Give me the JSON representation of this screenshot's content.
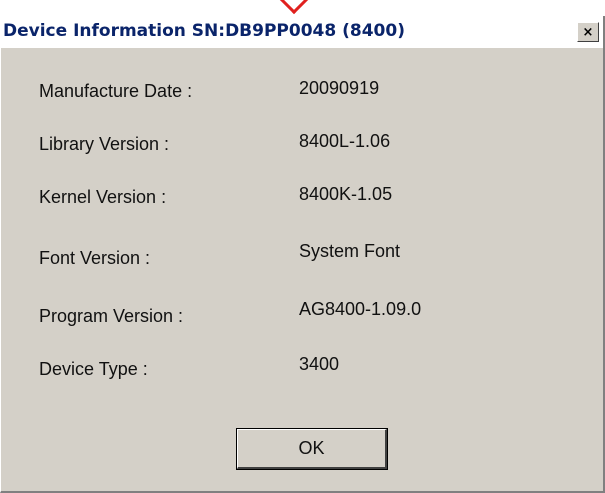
{
  "dialog": {
    "title": "Device Information SN:DB9PP0048 (8400)",
    "close_symbol": "×",
    "rows": [
      {
        "label": "Manufacture Date :",
        "value": "20090919"
      },
      {
        "label": "Library Version :",
        "value": "8400L-1.06"
      },
      {
        "label": "Kernel Version :",
        "value": "8400K-1.05"
      },
      {
        "label": "Font Version :",
        "value": "System Font"
      },
      {
        "label": "Program Version :",
        "value": "AG8400-1.09.0"
      },
      {
        "label": "Device Type :",
        "value": "3400"
      }
    ],
    "ok_label": "OK"
  },
  "colors": {
    "dialog_bg": "#d4d0c8",
    "title_text": "#0a246a",
    "annotation_mark": "#e0201e"
  },
  "icons": {
    "close": "close-icon",
    "annotation": "red-chevron-mark"
  }
}
